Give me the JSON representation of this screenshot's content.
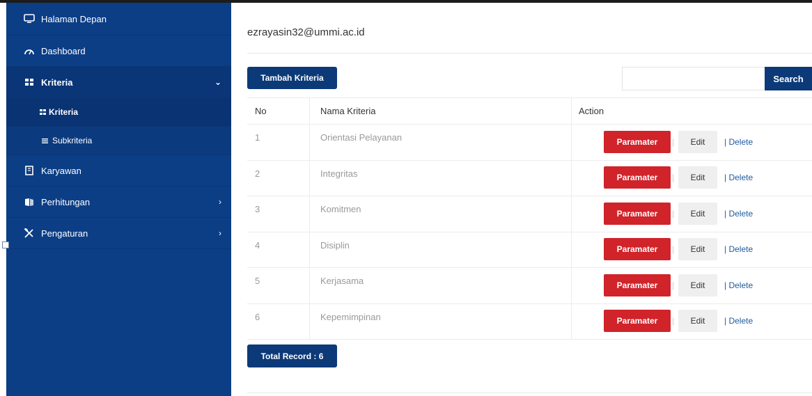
{
  "sidebar": {
    "items": [
      {
        "label": "Halaman Depan",
        "icon": "monitor-icon"
      },
      {
        "label": "Dashboard",
        "icon": "dashboard-icon"
      },
      {
        "label": "Kriteria",
        "icon": "grid-icon",
        "arrow": "⌄"
      },
      {
        "label": "Kriteria",
        "icon": "grid-icon"
      },
      {
        "label": "Subkriteria",
        "icon": "list-icon"
      },
      {
        "label": "Karyawan",
        "icon": "book-icon"
      },
      {
        "label": "Perhitungan",
        "icon": "folder-icon",
        "arrow": "›"
      },
      {
        "label": "Pengaturan",
        "icon": "tools-icon",
        "arrow": "›"
      }
    ]
  },
  "header": {
    "user_email": "ezrayasin32@ummi.ac.id"
  },
  "toolbar": {
    "add_label": "Tambah Kriteria",
    "search_placeholder": "",
    "search_label": "Search"
  },
  "table": {
    "columns": [
      "No",
      "Nama Kriteria",
      "Action"
    ],
    "rows": [
      {
        "no": "1",
        "name": "Orientasi Pelayanan"
      },
      {
        "no": "2",
        "name": "Integritas"
      },
      {
        "no": "3",
        "name": "Komitmen"
      },
      {
        "no": "4",
        "name": "Disiplin"
      },
      {
        "no": "5",
        "name": "Kerjasama"
      },
      {
        "no": "6",
        "name": "Kepemimpinan"
      }
    ],
    "actions": {
      "param": "Paramater",
      "separator": "|",
      "edit": "Edit",
      "delete": "| Delete"
    }
  },
  "footer": {
    "total_label": "Total Record : 6"
  },
  "colors": {
    "sidebar": "#0c3e86",
    "primary": "#0c3a78",
    "danger": "#d0232a"
  }
}
